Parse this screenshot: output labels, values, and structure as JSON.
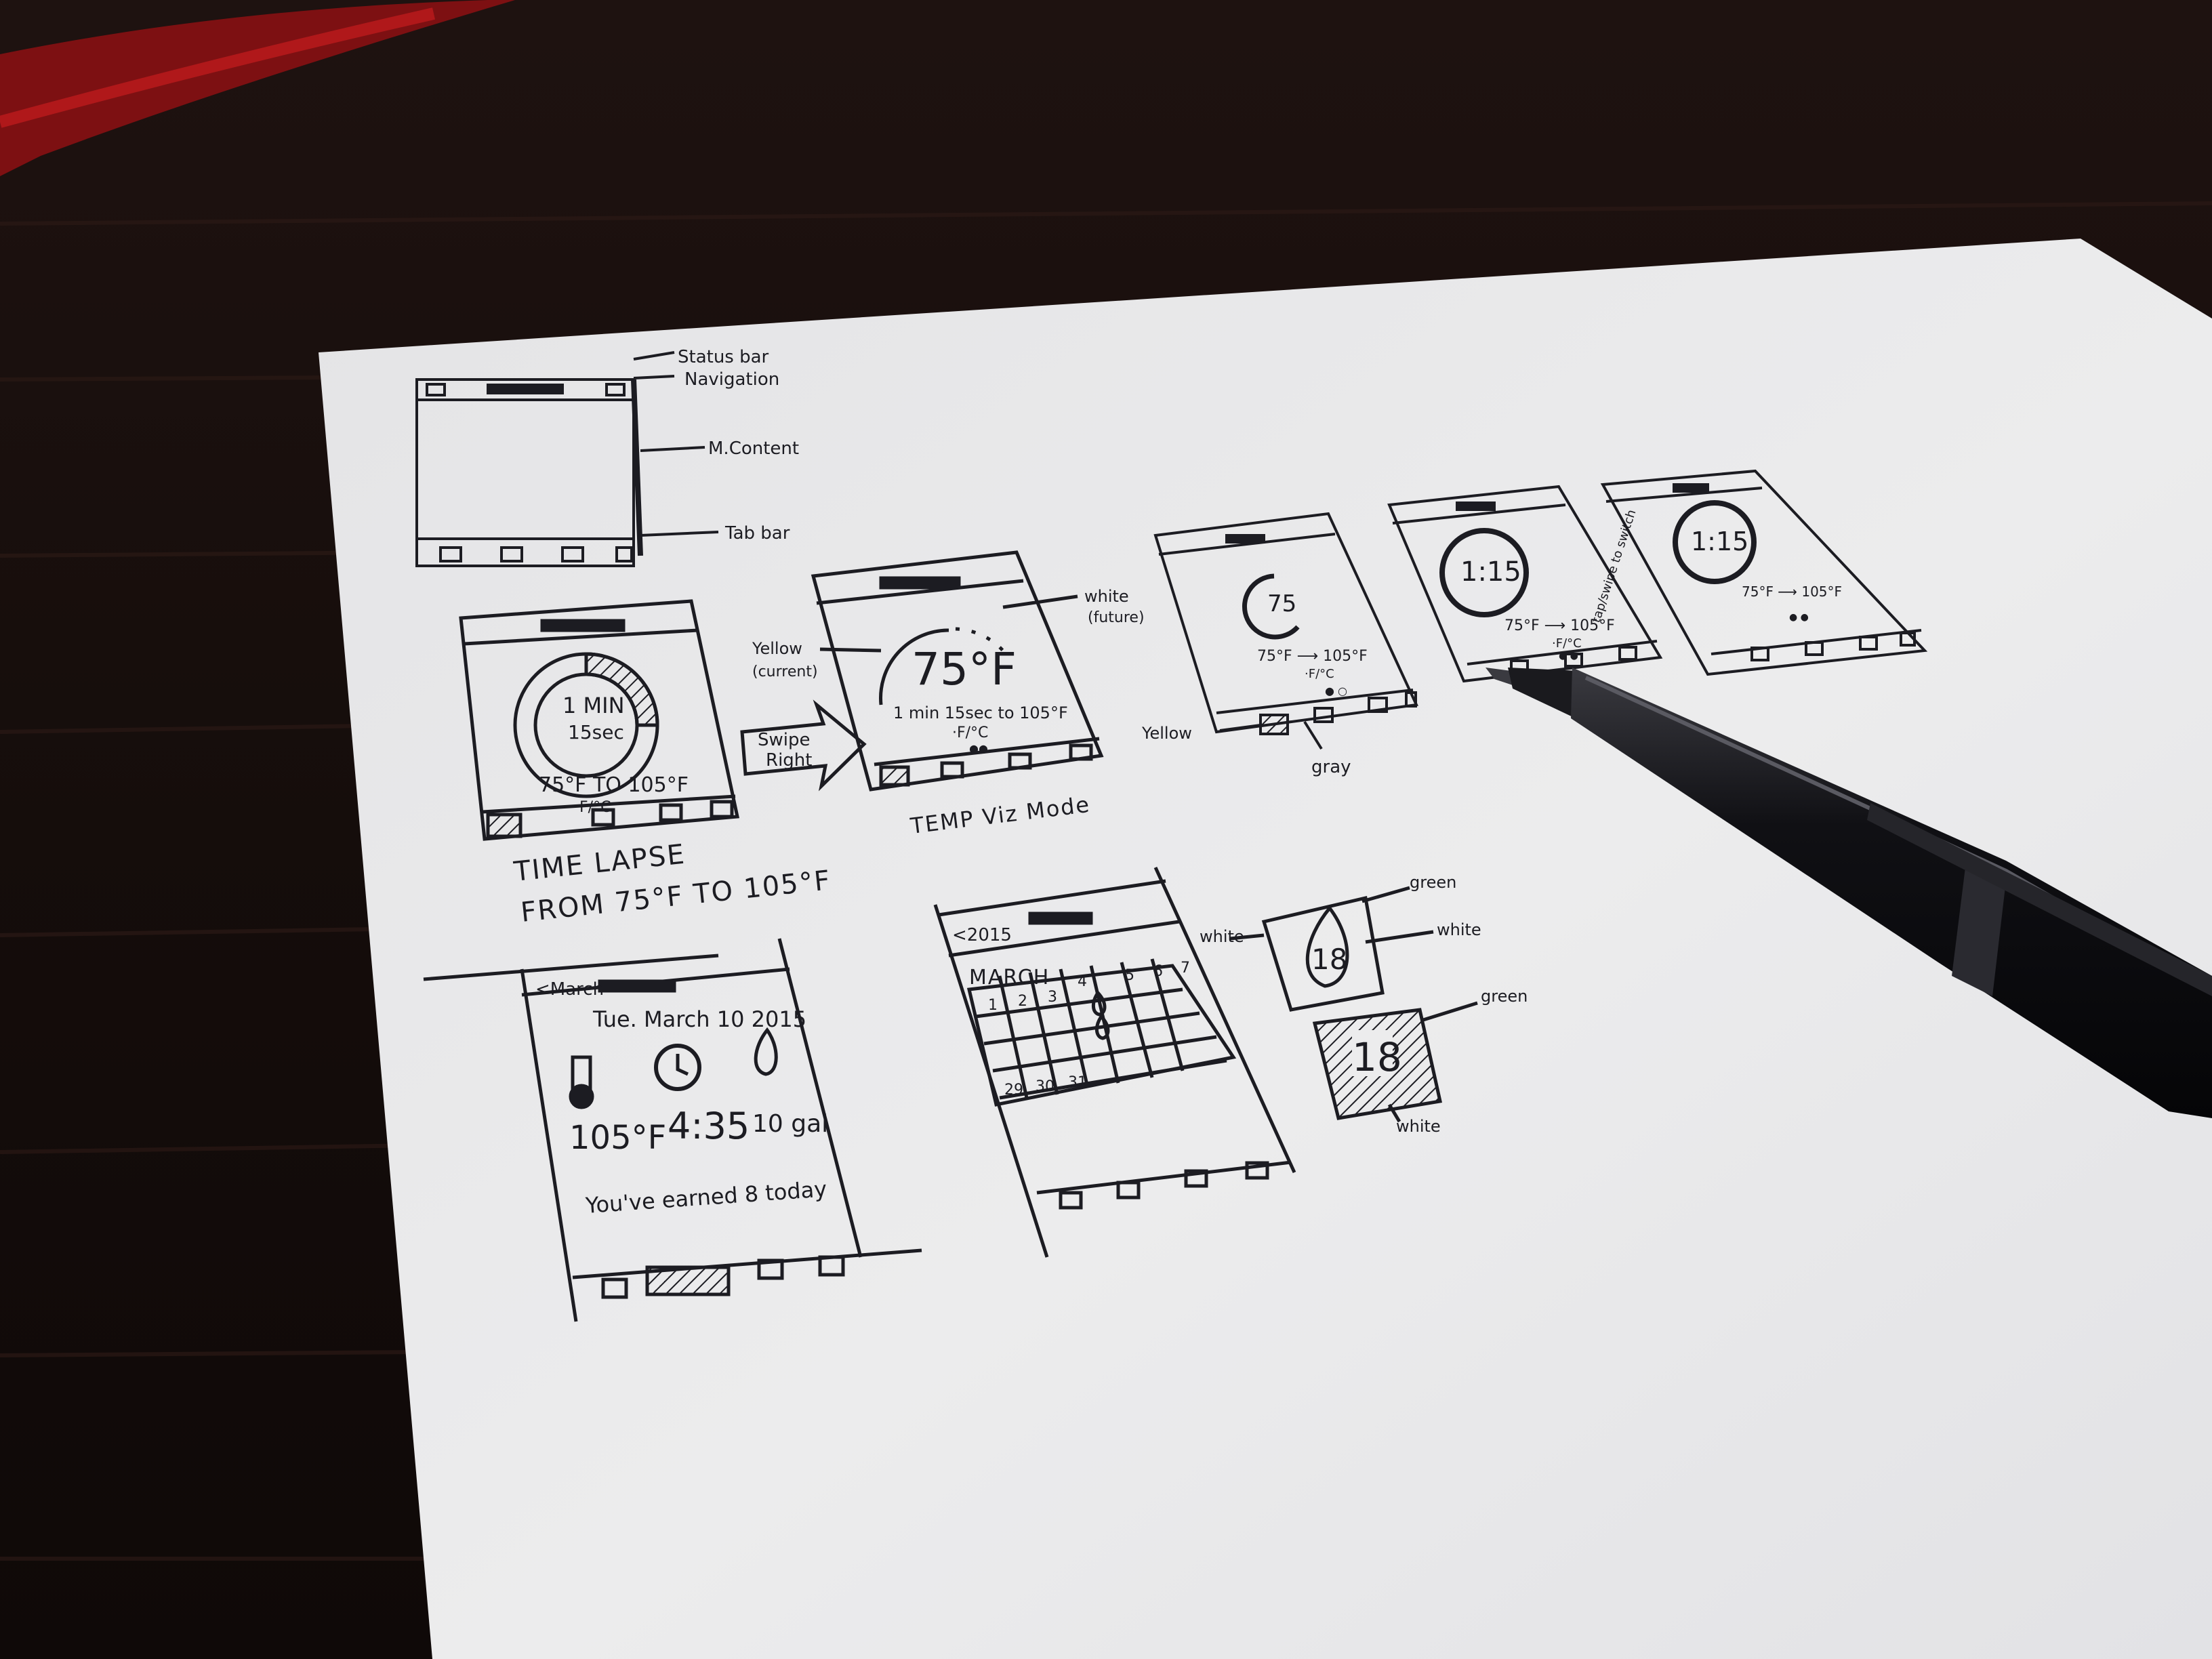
{
  "colors": {
    "desk": "#1a0f0d",
    "desk_grain": "#2a1a16",
    "cloth_red": "#8e1214",
    "paper": "#e9e9ea",
    "paper_shadow": "#c9c9cc",
    "ink": "#1c1c22",
    "pen_body": "#0d0d10"
  },
  "sketch": {
    "anatomy_labels": {
      "status_bar": "Status bar",
      "navigation": "Navigation",
      "main_content": "M.Content",
      "tab_bar": "Tab bar"
    },
    "timelapse_screen": {
      "ring_text_1": "1 MIN",
      "ring_text_2": "15sec",
      "range": "75°F TO 105°F",
      "unit": "F/°C",
      "caption_1": "TIME LAPSE",
      "caption_2": "FROM 75°F TO 105°F"
    },
    "swipe_label_1": "Swipe",
    "swipe_label_2": "Right",
    "temp_viz_screen": {
      "temp": "75°F",
      "subtitle": "1 min 15sec to 105°F",
      "unit": "·F/°C",
      "dots": "●●",
      "label_yellow_1": "Yellow",
      "label_yellow_2": "(current)",
      "label_white_1": "white",
      "label_white_2": "(future)",
      "caption": "TEMP Viz Mode"
    },
    "small_screen_a": {
      "temp": "75",
      "range": "75°F ⟶ 105°F",
      "unit": "·F/°C",
      "dots": "● ○",
      "label_yellow": "Yellow",
      "label_gray": "gray"
    },
    "small_screen_b": {
      "time": "1:15",
      "range": "75°F ⟶ 105°F",
      "unit": "·F/°C",
      "dots": "● ●"
    },
    "small_screen_c": {
      "time": "1:15",
      "range": "75°F ⟶ 105°F",
      "dots": "● ●",
      "side_note": "tap/swipe to switch"
    },
    "day_screen": {
      "back": "<March",
      "date": "Tue. March 10 2015",
      "temp": "105°F",
      "time": "4:35",
      "volume": "10 gal",
      "message": "You've earned 8 today"
    },
    "calendar_screen": {
      "back": "<2015",
      "month": "MARCH",
      "row1": [
        "1",
        "2",
        "3",
        "4",
        "5",
        "6",
        "7"
      ],
      "row_last": [
        "29",
        "30",
        "31"
      ]
    },
    "badge_outline": {
      "number": "18",
      "label_green": "green",
      "label_white_left": "white",
      "label_white_right": "white"
    },
    "badge_filled": {
      "number": "18",
      "label_green": "green",
      "label_white": "white"
    }
  }
}
